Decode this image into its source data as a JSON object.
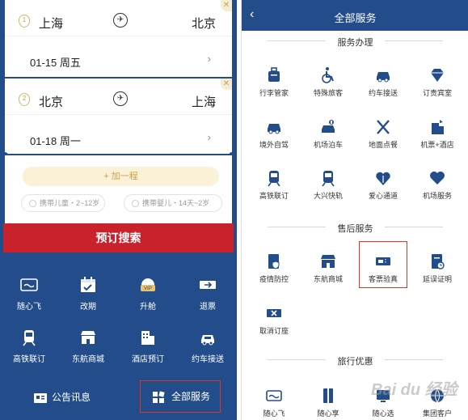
{
  "left": {
    "trip1": {
      "from": "上海",
      "to": "北京",
      "date": "01-15 周五",
      "index": "1"
    },
    "trip2": {
      "from": "北京",
      "to": "上海",
      "date": "01-18 周一",
      "index": "2"
    },
    "add_leg": "+ 加一程",
    "pax_child": "携带儿童・2~12岁",
    "pax_infant": "携带婴儿・14天~2岁",
    "search_btn": "预订搜索",
    "services": [
      {
        "label": "随心飞",
        "icon": "card-icon"
      },
      {
        "label": "改期",
        "icon": "calendar-icon"
      },
      {
        "label": "升舱",
        "icon": "seat-upgrade-icon"
      },
      {
        "label": "退票",
        "icon": "ticket-refund-icon"
      },
      {
        "label": "高铁联订",
        "icon": "train-icon"
      },
      {
        "label": "东航商城",
        "icon": "shop-icon"
      },
      {
        "label": "酒店预订",
        "icon": "hotel-icon"
      },
      {
        "label": "约车接送",
        "icon": "car-icon"
      }
    ],
    "notice": "公告讯息",
    "all_services": "全部服务"
  },
  "right": {
    "title": "全部服务",
    "sections": {
      "handle": "服务办理",
      "after": "售后服务",
      "deals": "旅行优惠"
    },
    "handle_items": [
      "行李管家",
      "特殊旅客",
      "约车接送",
      "订贵宾室",
      "境外自驾",
      "机场泊车",
      "地面点餐",
      "机票+酒店",
      "高铁联订",
      "大兴快轨",
      "爱心通道",
      "机场服务"
    ],
    "after_items": [
      "疫情防控",
      "东航商城",
      "客票验真",
      "延误证明",
      "取消订座"
    ],
    "deal_items": [
      "随心飞",
      "随心享",
      "随心选",
      "集团客户"
    ],
    "watermark": "Bai du 经验"
  },
  "colors": {
    "navy": "#234d8a",
    "red": "#c9222c",
    "gold": "#c9a24f"
  }
}
